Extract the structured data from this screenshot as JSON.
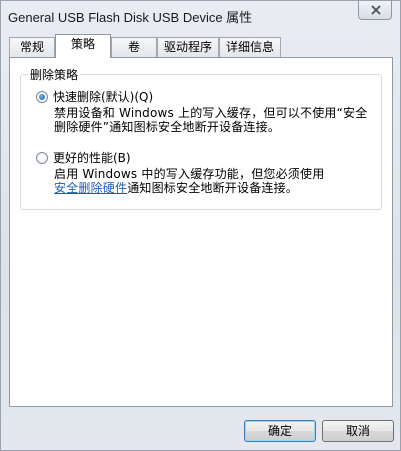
{
  "window": {
    "title": "General USB Flash Disk USB Device 属性"
  },
  "tabs": [
    {
      "label": "常规"
    },
    {
      "label": "策略"
    },
    {
      "label": "卷"
    },
    {
      "label": "驱动程序"
    },
    {
      "label": "详细信息"
    }
  ],
  "active_tab": "策略",
  "group": {
    "label": "删除策略",
    "options": [
      {
        "label": "快速删除(默认)(Q)",
        "selected": true,
        "desc_line1": "禁用设备和 Windows 上的写入缓存，但可以不使用“安全",
        "desc_line2": "删除硬件”通知图标安全地断开设备连接。"
      },
      {
        "label": "更好的性能(B)",
        "selected": false,
        "desc_line1": "启用 Windows 中的写入缓存功能，但您必须使用",
        "desc_link": "安全删除硬件",
        "desc_line2_rest": "通知图标安全地断开设备连接。"
      }
    ]
  },
  "buttons": {
    "ok": "确定",
    "cancel": "取消"
  }
}
